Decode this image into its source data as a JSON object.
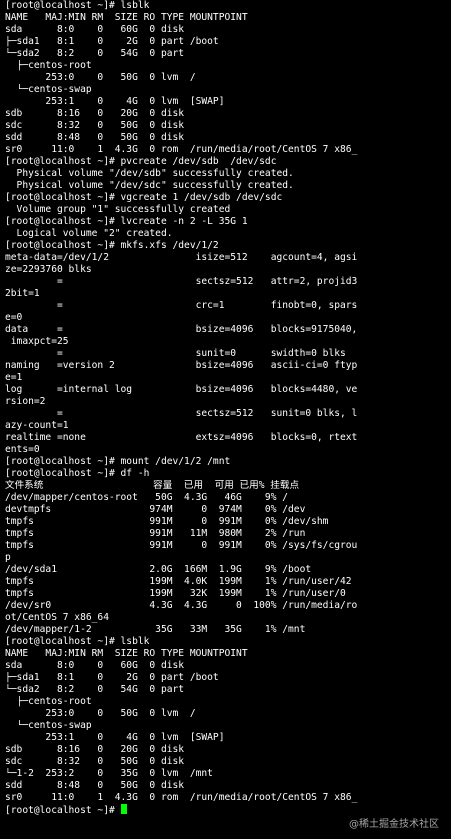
{
  "terminal": {
    "lines": [
      "[root@localhost ~]# lsblk",
      "NAME   MAJ:MIN RM  SIZE RO TYPE MOUNTPOINT",
      "sda      8:0    0   60G  0 disk",
      "├─sda1   8:1    0    2G  0 part /boot",
      "└─sda2   8:2    0   54G  0 part",
      "  ├─centos-root",
      "       253:0    0   50G  0 lvm  /",
      "  └─centos-swap",
      "       253:1    0    4G  0 lvm  [SWAP]",
      "sdb      8:16   0   20G  0 disk",
      "sdc      8:32   0   50G  0 disk",
      "sdd      8:48   0   50G  0 disk",
      "sr0     11:0    1  4.3G  0 rom  /run/media/root/CentOS 7 x86_",
      "[root@localhost ~]# pvcreate /dev/sdb  /dev/sdc",
      "  Physical volume \"/dev/sdb\" successfully created.",
      "  Physical volume \"/dev/sdc\" successfully created.",
      "[root@localhost ~]# vgcreate 1 /dev/sdb /dev/sdc",
      "  Volume group \"1\" successfully created",
      "[root@localhost ~]# lvcreate -n 2 -L 35G 1",
      "  Logical volume \"2\" created.",
      "[root@localhost ~]# mkfs.xfs /dev/1/2",
      "meta-data=/dev/1/2               isize=512    agcount=4, agsi",
      "ze=2293760 blks",
      "         =                       sectsz=512   attr=2, projid3",
      "2bit=1",
      "         =                       crc=1        finobt=0, spars",
      "e=0",
      "data     =                       bsize=4096   blocks=9175040,",
      " imaxpct=25",
      "         =                       sunit=0      swidth=0 blks",
      "naming   =version 2              bsize=4096   ascii-ci=0 ftyp",
      "e=1",
      "log      =internal log           bsize=4096   blocks=4480, ve",
      "rsion=2",
      "         =                       sectsz=512   sunit=0 blks, l",
      "azy-count=1",
      "realtime =none                   extsz=4096   blocks=0, rtext",
      "ents=0",
      "[root@localhost ~]# mount /dev/1/2 /mnt",
      "[root@localhost ~]# df -h",
      "文件系统                   容量  已用  可用 已用% 挂载点",
      "/dev/mapper/centos-root   50G  4.3G   46G    9% /",
      "devtmpfs                 974M     0  974M    0% /dev",
      "tmpfs                    991M     0  991M    0% /dev/shm",
      "tmpfs                    991M   11M  980M    2% /run",
      "tmpfs                    991M     0  991M    0% /sys/fs/cgrou",
      "p",
      "/dev/sda1                2.0G  166M  1.9G    9% /boot",
      "tmpfs                    199M  4.0K  199M    1% /run/user/42",
      "tmpfs                    199M   32K  199M    1% /run/user/0",
      "/dev/sr0                 4.3G  4.3G     0  100% /run/media/ro",
      "ot/CentOS 7 x86_64",
      "/dev/mapper/1-2           35G   33M   35G    1% /mnt",
      "[root@localhost ~]# lsblk",
      "NAME   MAJ:MIN RM  SIZE RO TYPE MOUNTPOINT",
      "sda      8:0    0   60G  0 disk",
      "├─sda1   8:1    0    2G  0 part /boot",
      "└─sda2   8:2    0   54G  0 part",
      "  ├─centos-root",
      "       253:0    0   50G  0 lvm  /",
      "  └─centos-swap",
      "       253:1    0    4G  0 lvm  [SWAP]",
      "sdb      8:16   0   20G  0 disk",
      "sdc      8:32   0   50G  0 disk",
      "└─1-2  253:2    0   35G  0 lvm  /mnt",
      "sdd      8:48   0   50G  0 disk",
      "sr0     11:0    1  4.3G  0 rom  /run/media/root/CentOS 7 x86_"
    ],
    "prompt": "[root@localhost ~]# "
  },
  "watermark": "@稀土掘金技术社区",
  "colors": {
    "background": "#000000",
    "text": "#ffffff",
    "cursor": "#00ff00"
  }
}
